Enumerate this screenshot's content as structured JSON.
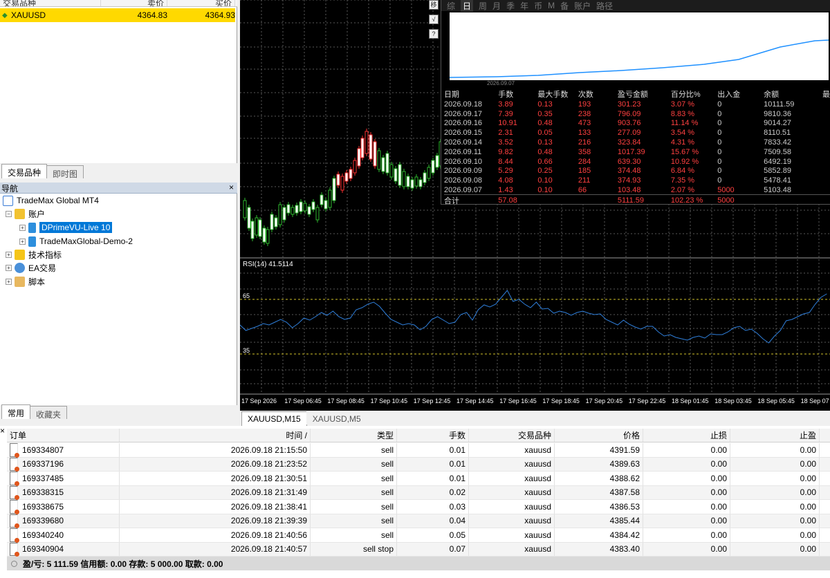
{
  "market_watch": {
    "headers": [
      "交易品种",
      "卖价",
      "买价"
    ],
    "row": {
      "symbol": "XAUUSD",
      "bid": "4364.83",
      "ask": "4364.93"
    },
    "tabs": [
      "交易品种",
      "即时图"
    ]
  },
  "navigator": {
    "title": "导航",
    "root": "TradeMax Global MT4",
    "accounts": "账户",
    "account_live": "DPrimeVU-Live 10",
    "account_demo": "TradeMaxGlobal-Demo-2",
    "indicators": "技术指标",
    "ea": "EA交易",
    "scripts": "脚本",
    "tabs": [
      "常用",
      "收藏夹"
    ]
  },
  "stats_panel": {
    "period_tabs": [
      "综",
      "日",
      "周",
      "月",
      "季",
      "年",
      "币",
      "M",
      "备",
      "账户",
      "路径"
    ],
    "active_tab": "日",
    "curve_start_label": "2026.09.07",
    "columns": [
      "日期",
      "手数",
      "最大手数",
      "次数",
      "盈亏金额",
      "百分比%",
      "出入金",
      "余额",
      "最"
    ],
    "rows": [
      [
        "2026.09.18",
        "3.89",
        "0.13",
        "193",
        "301.23",
        "3.07 %",
        "0",
        "10111.59"
      ],
      [
        "2026.09.17",
        "7.39",
        "0.35",
        "238",
        "796.09",
        "8.83 %",
        "0",
        "9810.36"
      ],
      [
        "2026.09.16",
        "10.91",
        "0.48",
        "473",
        "903.76",
        "11.14 %",
        "0",
        "9014.27"
      ],
      [
        "2026.09.15",
        "2.31",
        "0.05",
        "133",
        "277.09",
        "3.54 %",
        "0",
        "8110.51"
      ],
      [
        "2026.09.14",
        "3.52",
        "0.13",
        "216",
        "323.84",
        "4.31 %",
        "0",
        "7833.42"
      ],
      [
        "2026.09.11",
        "9.82",
        "0.48",
        "358",
        "1017.39",
        "15.67 %",
        "0",
        "7509.58"
      ],
      [
        "2026.09.10",
        "8.44",
        "0.66",
        "284",
        "639.30",
        "10.92 %",
        "0",
        "6492.19"
      ],
      [
        "2026.09.09",
        "5.29",
        "0.25",
        "185",
        "374.48",
        "6.84 %",
        "0",
        "5852.89"
      ],
      [
        "2026.09.08",
        "4.08",
        "0.10",
        "211",
        "374.93",
        "7.35 %",
        "0",
        "5478.41"
      ],
      [
        "2026.09.07",
        "1.43",
        "0.10",
        "66",
        "103.48",
        "2.07 %",
        "5000",
        "5103.48"
      ]
    ],
    "total": [
      "合计",
      "57.08",
      "",
      "",
      "5111.59",
      "102.23 %",
      "5000",
      ""
    ]
  },
  "chart": {
    "rsi_label": "RSI(14) 41.5114",
    "rsi_high": "65",
    "rsi_low": "35",
    "time_labels": [
      "17 Sep 2026",
      "17 Sep 06:45",
      "17 Sep 08:45",
      "17 Sep 10:45",
      "17 Sep 12:45",
      "17 Sep 14:45",
      "17 Sep 16:45",
      "17 Sep 18:45",
      "17 Sep 20:45",
      "17 Sep 22:45",
      "18 Sep 01:45",
      "18 Sep 03:45",
      "18 Sep 05:45",
      "18 Sep 07"
    ],
    "tabs": [
      "XAUUSD,M15",
      "XAUUSD,M5"
    ],
    "tool_icons": [
      "移",
      "√",
      "?"
    ]
  },
  "orders": {
    "headers": [
      "订单",
      "时间 /",
      "类型",
      "手数",
      "交易品种",
      "价格",
      "止损",
      "止盈"
    ],
    "rows": [
      [
        "169334807",
        "2026.09.18 21:15:50",
        "sell",
        "0.01",
        "xauusd",
        "4391.59",
        "0.00",
        "0.00"
      ],
      [
        "169337196",
        "2026.09.18 21:23:52",
        "sell",
        "0.01",
        "xauusd",
        "4389.63",
        "0.00",
        "0.00"
      ],
      [
        "169337485",
        "2026.09.18 21:30:51",
        "sell",
        "0.01",
        "xauusd",
        "4388.62",
        "0.00",
        "0.00"
      ],
      [
        "169338315",
        "2026.09.18 21:31:49",
        "sell",
        "0.02",
        "xauusd",
        "4387.58",
        "0.00",
        "0.00"
      ],
      [
        "169338675",
        "2026.09.18 21:38:41",
        "sell",
        "0.03",
        "xauusd",
        "4386.53",
        "0.00",
        "0.00"
      ],
      [
        "169339680",
        "2026.09.18 21:39:39",
        "sell",
        "0.04",
        "xauusd",
        "4385.44",
        "0.00",
        "0.00"
      ],
      [
        "169340240",
        "2026.09.18 21:40:56",
        "sell",
        "0.05",
        "xauusd",
        "4384.42",
        "0.00",
        "0.00"
      ],
      [
        "169340904",
        "2026.09.18 21:40:57",
        "sell stop",
        "0.07",
        "xauusd",
        "4383.40",
        "0.00",
        "0.00"
      ]
    ],
    "summary": "盈/亏: 5 111.59  信用额: 0.00  存款: 5 000.00  取款: 0.00"
  },
  "colors": {
    "highlight": "#ffd900",
    "profit_red": "#ff4040",
    "curve_blue": "#1e90ff",
    "selection": "#0078d7"
  }
}
